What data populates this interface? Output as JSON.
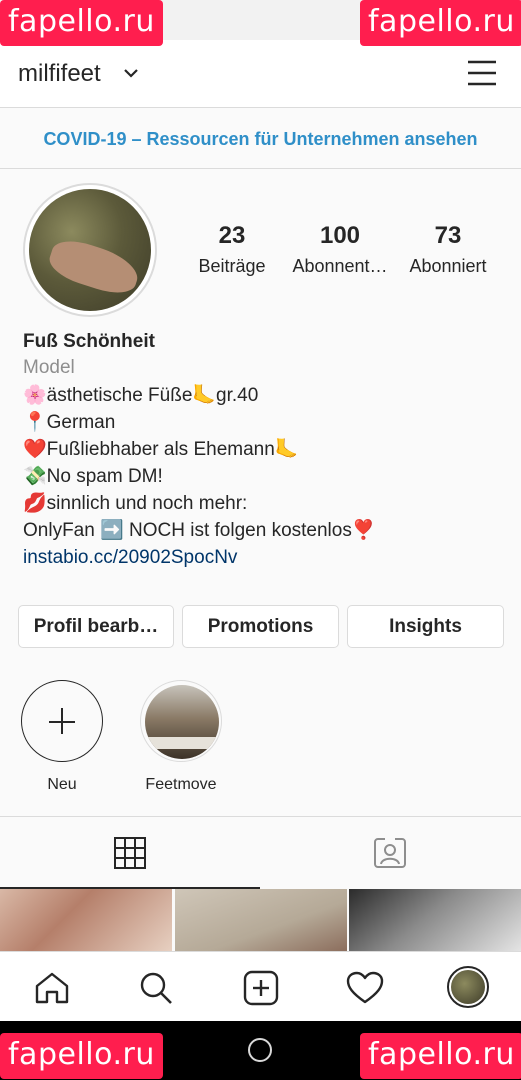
{
  "watermarks": {
    "text": "fapello.ru",
    "color": "#ff1e4e"
  },
  "header": {
    "username": "milfifeet",
    "chevron_icon": "chevron-down-icon",
    "menu_icon": "hamburger-menu-icon"
  },
  "banner": {
    "text": "COVID-19 – Ressourcen für Unternehmen ansehen"
  },
  "profile": {
    "stats": [
      {
        "value": "23",
        "label": "Beiträge"
      },
      {
        "value": "100",
        "label": "Abonnent…"
      },
      {
        "value": "73",
        "label": "Abonniert"
      }
    ],
    "name": "Fuß Schönheit",
    "category": "Model",
    "bio_lines": [
      "🌸ästhetische Füße🦶gr.40",
      "📍German",
      "❤️Fußliebhaber als Ehemann🦶",
      "💸No spam DM!",
      "💋sinnlich und noch mehr:",
      "OnlyFan ➡️ NOCH ist folgen kostenlos❣️"
    ],
    "link": "instabio.cc/20902SpocNv"
  },
  "buttons": {
    "edit": "Profil bearb…",
    "promotions": "Promotions",
    "insights": "Insights"
  },
  "highlights": [
    {
      "label": "Neu"
    },
    {
      "label": "Feetmove"
    }
  ],
  "tabs": [
    {
      "icon": "grid-icon"
    },
    {
      "icon": "tagged-person-icon"
    }
  ],
  "bottom_nav": [
    "home-icon",
    "search-icon",
    "new-post-icon",
    "heart-icon",
    "profile-avatar-icon"
  ]
}
